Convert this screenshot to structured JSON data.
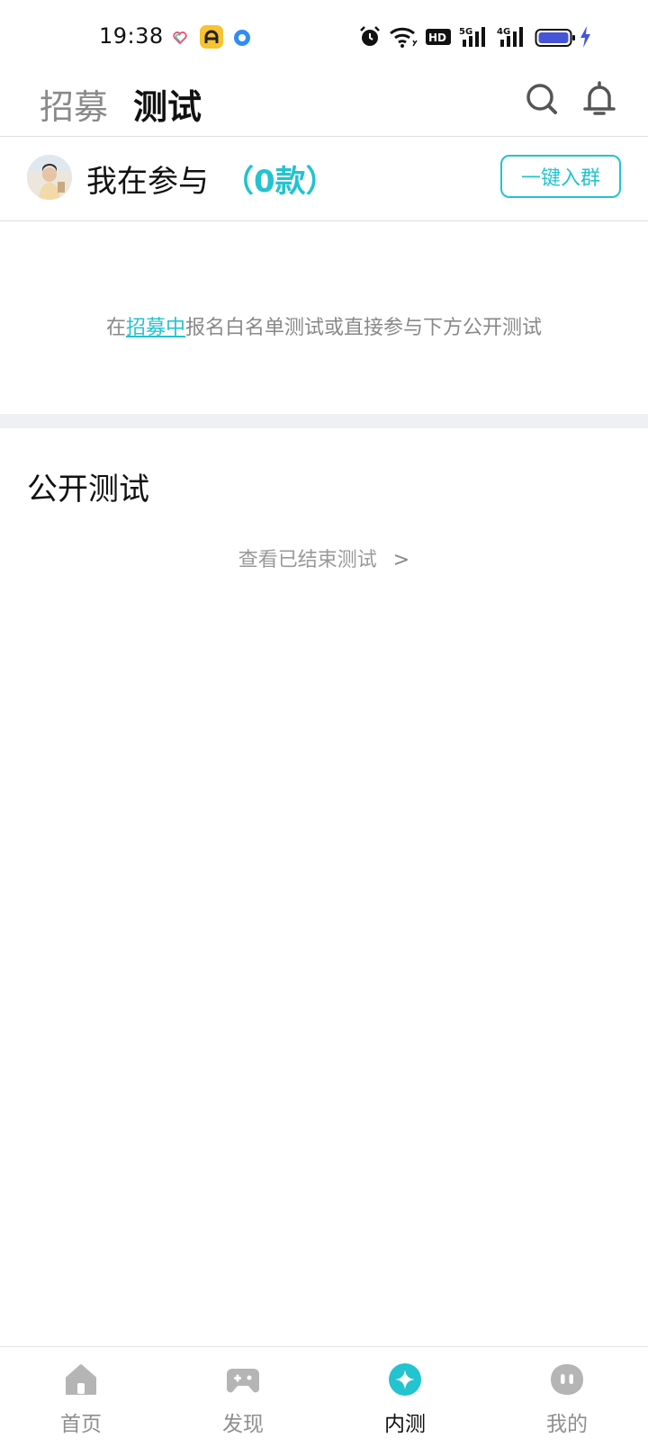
{
  "status_bar": {
    "time": "19:38",
    "icons": [
      "heart-icon",
      "app-a-icon",
      "blue-dot-icon",
      "alarm-icon",
      "wifi-icon",
      "hd-icon",
      "signal-5g-icon",
      "signal-4g-icon",
      "battery-icon",
      "charging-icon"
    ],
    "hd_label": "HD",
    "net1_label": "5G",
    "net2_label": "4G"
  },
  "header": {
    "tabs": [
      {
        "label": "招募",
        "active": false
      },
      {
        "label": "测试",
        "active": true
      }
    ],
    "icons": [
      "search-icon",
      "bell-icon"
    ]
  },
  "participating": {
    "title": "我在参与",
    "count": "（0款）",
    "join_button": "一键入群"
  },
  "hint": {
    "prefix": "在",
    "link": "招募中",
    "suffix": "报名白名单测试或直接参与下方公开测试"
  },
  "public_test": {
    "title": "公开测试",
    "view_ended": "查看已结束测试",
    "chevron": ">"
  },
  "bottom_nav": {
    "items": [
      {
        "label": "首页",
        "icon": "home-icon",
        "active": false
      },
      {
        "label": "发现",
        "icon": "gamepad-icon",
        "active": false
      },
      {
        "label": "内测",
        "icon": "beta-test-icon",
        "active": true
      },
      {
        "label": "我的",
        "icon": "profile-icon",
        "active": false
      }
    ]
  },
  "colors": {
    "accent": "#23c3cf",
    "inactive": "#8f8f8f",
    "divider": "#eef0f3"
  }
}
